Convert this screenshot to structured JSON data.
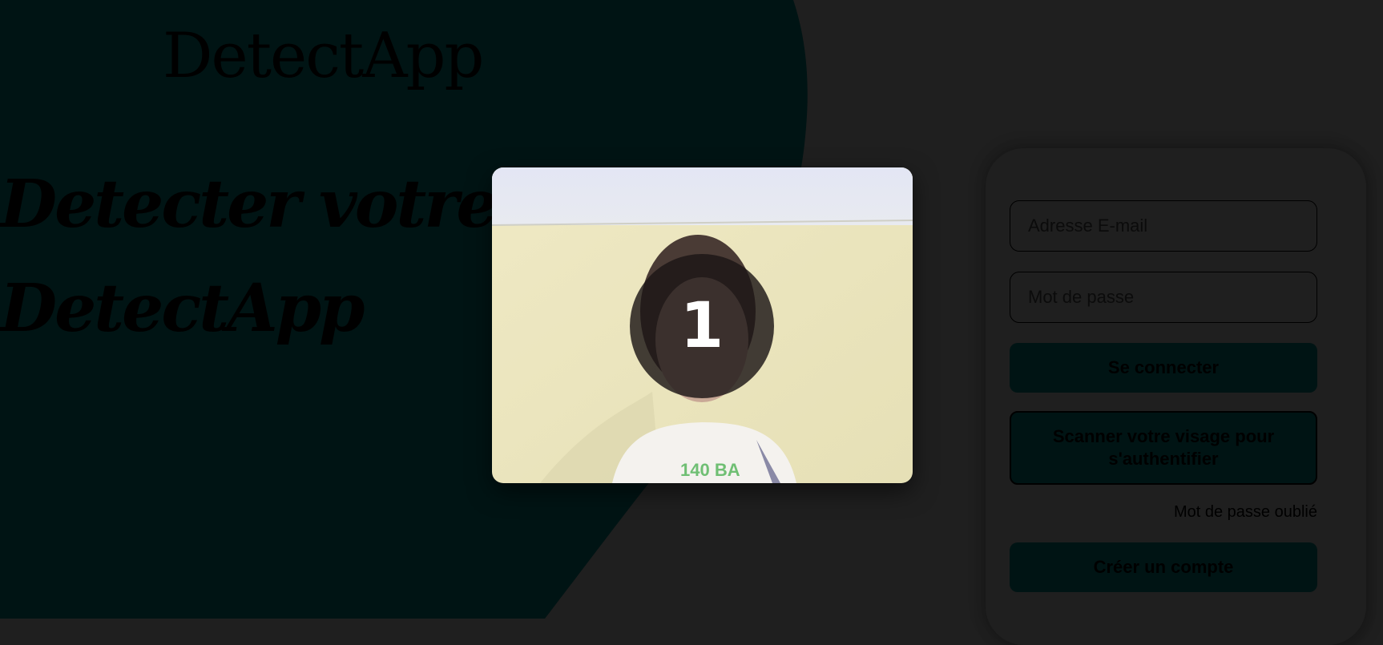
{
  "brand": {
    "name": "DetectApp"
  },
  "hero": {
    "line1": "Detecter votre maladie",
    "line2": "DetectApp"
  },
  "login": {
    "email_placeholder": "Adresse E-mail",
    "password_placeholder": "Mot de passe",
    "login_button": "Se connecter",
    "face_scan_button": "Scanner votre visage pour s'authentifier",
    "forgot_link": "Mot de passe oublié",
    "signup_button": "Créer un compte"
  },
  "camera": {
    "countdown": "1"
  },
  "colors": {
    "page_background": "#1f1f1f",
    "blob": "#001414",
    "button": "#001414"
  },
  "icons": [
    "webcam-feed"
  ]
}
